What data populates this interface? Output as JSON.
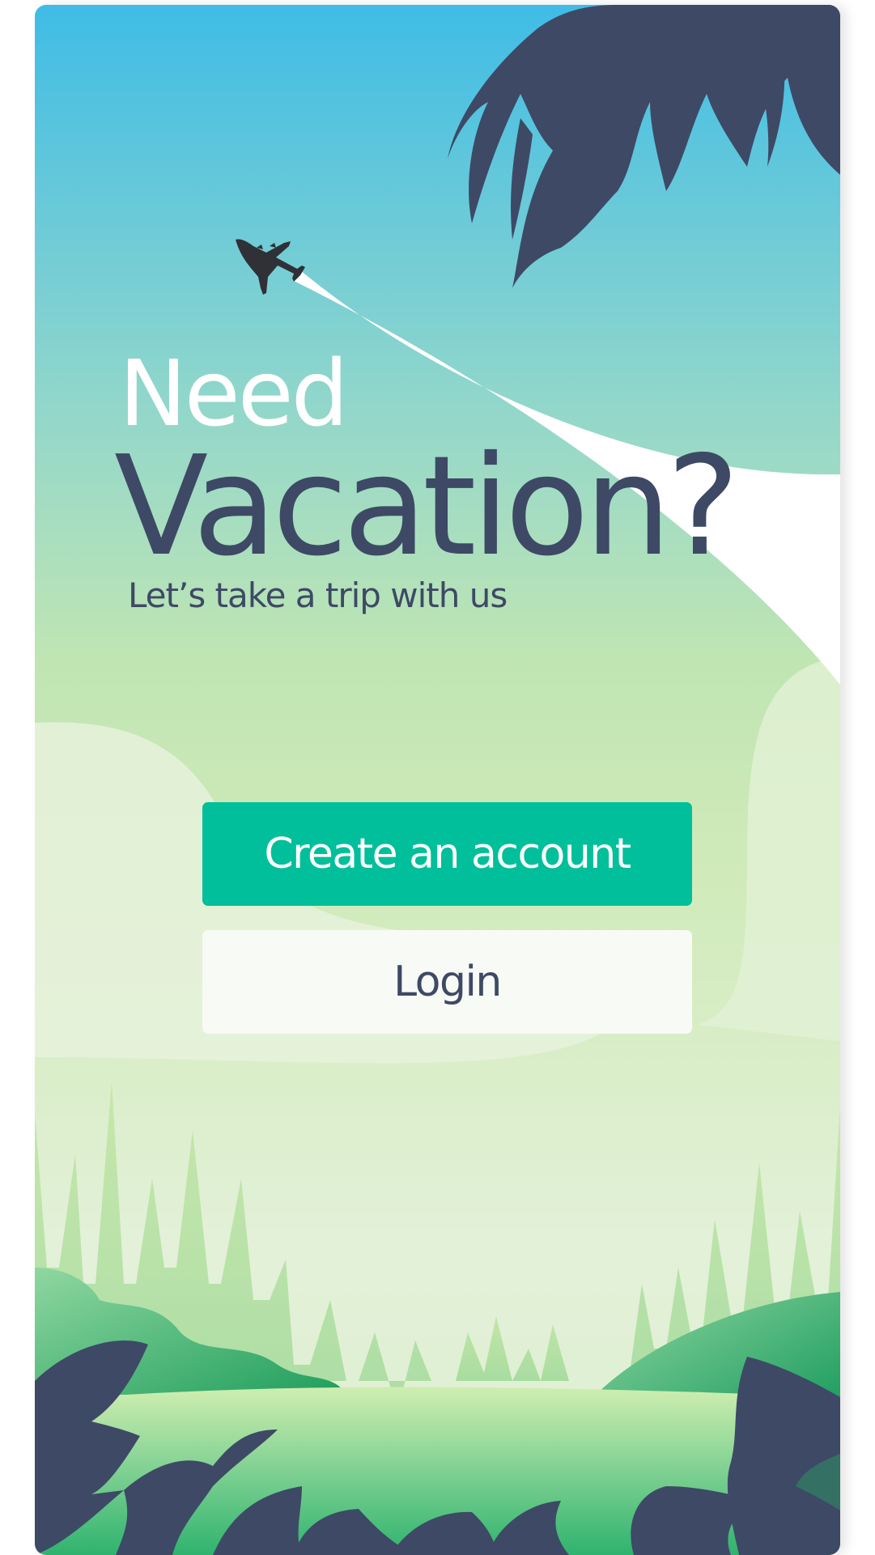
{
  "hero": {
    "line1": "Need",
    "line2": "Vacation?",
    "subtitle": "Let’s take a trip with us"
  },
  "actions": {
    "create_account_label": "Create an account",
    "login_label": "Login"
  },
  "icons": [
    "airplane-icon"
  ],
  "colors": {
    "accent": "#00bf9a",
    "text_dark": "#3e4966",
    "sky_top": "#3fbce6",
    "meadow": "#cfeab8"
  }
}
